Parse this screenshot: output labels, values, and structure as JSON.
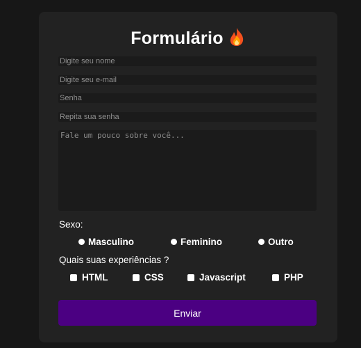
{
  "form": {
    "title": "Formulário",
    "title_icon": "fire-icon",
    "fields": {
      "name_placeholder": "Digite seu nome",
      "email_placeholder": "Digite seu e-mail",
      "password_placeholder": "Senha",
      "password_confirm_placeholder": "Repita sua senha",
      "about_placeholder": "Fale um pouco sobre você..."
    },
    "gender": {
      "label": "Sexo:",
      "options": [
        "Masculino",
        "Feminino",
        "Outro"
      ]
    },
    "experience": {
      "label": "Quais suas experiências ?",
      "options": [
        "HTML",
        "CSS",
        "Javascript",
        "PHP"
      ]
    },
    "submit_label": "Enviar"
  },
  "colors": {
    "page_background": "#171717",
    "card_background": "#222222",
    "input_background": "#1b1b1b",
    "submit_background": "#4b0082",
    "text": "#ffffff"
  }
}
